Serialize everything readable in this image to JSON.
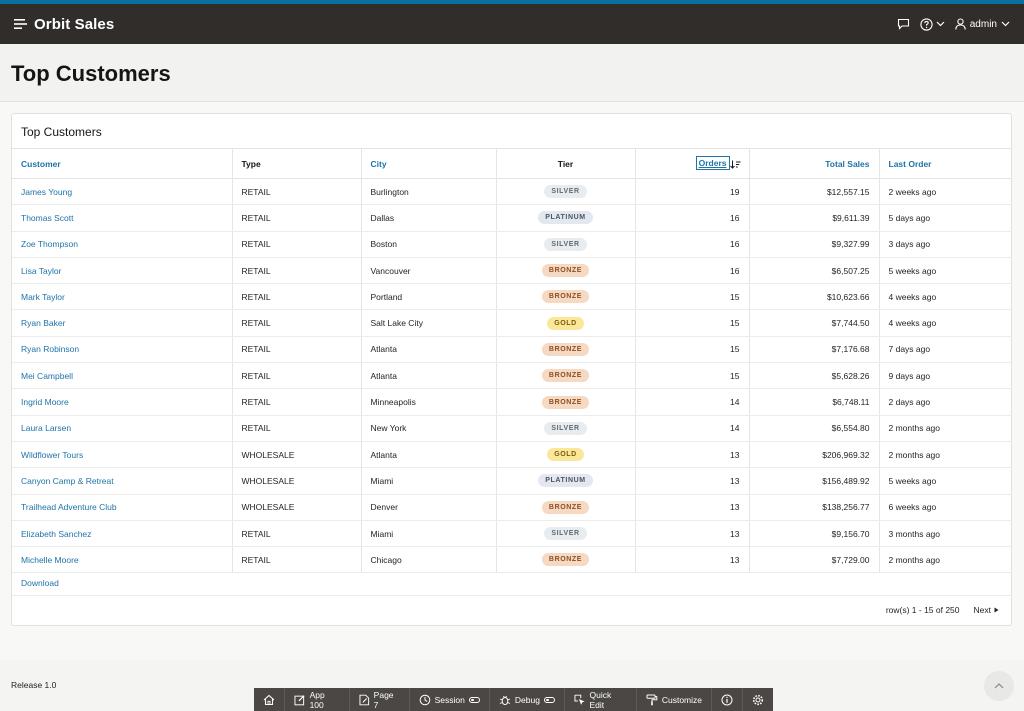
{
  "header": {
    "app_title": "Orbit Sales",
    "user_name": "admin"
  },
  "page": {
    "title": "Top Customers"
  },
  "region": {
    "title": "Top Customers",
    "columns": {
      "customer": "Customer",
      "type": "Type",
      "city": "City",
      "tier": "Tier",
      "orders": "Orders",
      "total_sales": "Total Sales",
      "last_order": "Last Order"
    },
    "rows": [
      {
        "customer": "James Young",
        "type": "RETAIL",
        "city": "Burlington",
        "tier": "SILVER",
        "orders": "19",
        "total_sales": "$12,557.15",
        "last_order": "2 weeks ago"
      },
      {
        "customer": "Thomas Scott",
        "type": "RETAIL",
        "city": "Dallas",
        "tier": "PLATINUM",
        "orders": "16",
        "total_sales": "$9,611.39",
        "last_order": "5 days ago"
      },
      {
        "customer": "Zoe Thompson",
        "type": "RETAIL",
        "city": "Boston",
        "tier": "SILVER",
        "orders": "16",
        "total_sales": "$9,327.99",
        "last_order": "3 days ago"
      },
      {
        "customer": "Lisa Taylor",
        "type": "RETAIL",
        "city": "Vancouver",
        "tier": "BRONZE",
        "orders": "16",
        "total_sales": "$6,507.25",
        "last_order": "5 weeks ago"
      },
      {
        "customer": "Mark Taylor",
        "type": "RETAIL",
        "city": "Portland",
        "tier": "BRONZE",
        "orders": "15",
        "total_sales": "$10,623.66",
        "last_order": "4 weeks ago"
      },
      {
        "customer": "Ryan Baker",
        "type": "RETAIL",
        "city": "Salt Lake City",
        "tier": "GOLD",
        "orders": "15",
        "total_sales": "$7,744.50",
        "last_order": "4 weeks ago"
      },
      {
        "customer": "Ryan Robinson",
        "type": "RETAIL",
        "city": "Atlanta",
        "tier": "BRONZE",
        "orders": "15",
        "total_sales": "$7,176.68",
        "last_order": "7 days ago"
      },
      {
        "customer": "Mei Campbell",
        "type": "RETAIL",
        "city": "Atlanta",
        "tier": "BRONZE",
        "orders": "15",
        "total_sales": "$5,628.26",
        "last_order": "9 days ago"
      },
      {
        "customer": "Ingrid Moore",
        "type": "RETAIL",
        "city": "Minneapolis",
        "tier": "BRONZE",
        "orders": "14",
        "total_sales": "$6,748.11",
        "last_order": "2 days ago"
      },
      {
        "customer": "Laura Larsen",
        "type": "RETAIL",
        "city": "New York",
        "tier": "SILVER",
        "orders": "14",
        "total_sales": "$6,554.80",
        "last_order": "2 months ago"
      },
      {
        "customer": "Wildflower Tours",
        "type": "WHOLESALE",
        "city": "Atlanta",
        "tier": "GOLD",
        "orders": "13",
        "total_sales": "$206,969.32",
        "last_order": "2 months ago"
      },
      {
        "customer": "Canyon Camp & Retreat",
        "type": "WHOLESALE",
        "city": "Miami",
        "tier": "PLATINUM",
        "orders": "13",
        "total_sales": "$156,489.92",
        "last_order": "5 weeks ago"
      },
      {
        "customer": "Trailhead Adventure Club",
        "type": "WHOLESALE",
        "city": "Denver",
        "tier": "BRONZE",
        "orders": "13",
        "total_sales": "$138,256.77",
        "last_order": "6 weeks ago"
      },
      {
        "customer": "Elizabeth Sanchez",
        "type": "RETAIL",
        "city": "Miami",
        "tier": "SILVER",
        "orders": "13",
        "total_sales": "$9,156.70",
        "last_order": "3 months ago"
      },
      {
        "customer": "Michelle Moore",
        "type": "RETAIL",
        "city": "Chicago",
        "tier": "BRONZE",
        "orders": "13",
        "total_sales": "$7,729.00",
        "last_order": "2 months ago"
      }
    ],
    "download_label": "Download",
    "pagination_text": "row(s) 1 - 15 of 250",
    "next_label": "Next"
  },
  "footer": {
    "release": "Release 1.0"
  },
  "devbar": {
    "app": "App 100",
    "page": "Page 7",
    "session": "Session",
    "debug": "Debug",
    "quick_edit": "Quick Edit",
    "customize": "Customize"
  },
  "colors": {
    "header_bg": "#312d2a",
    "accent_strip": "#0b6fa0",
    "link": "#1e73a8",
    "badge_silver": "#e8ecef",
    "badge_platinum": "#e3e7f0",
    "badge_bronze": "#f6d9c2",
    "badge_gold": "#fbe79a"
  }
}
